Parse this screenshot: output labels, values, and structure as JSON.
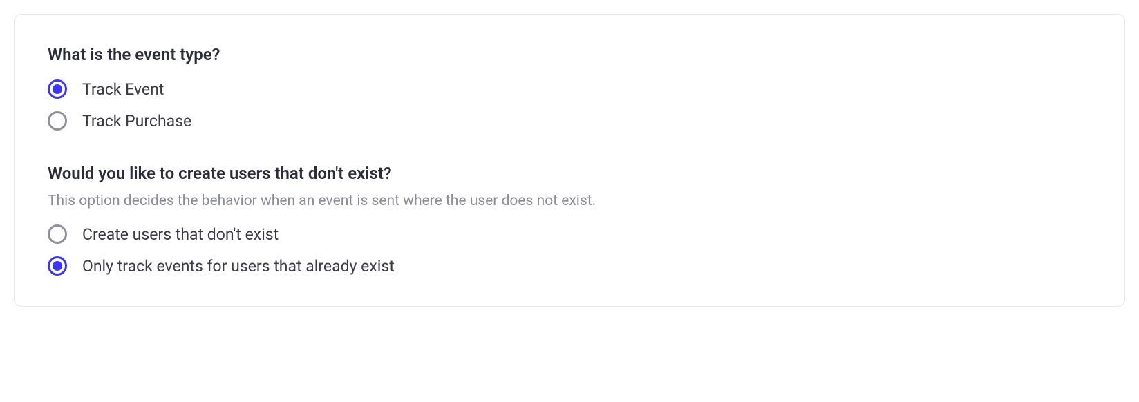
{
  "sections": [
    {
      "question": "What is the event type?",
      "helper": null,
      "options": [
        {
          "label": "Track Event",
          "selected": true
        },
        {
          "label": "Track Purchase",
          "selected": false
        }
      ]
    },
    {
      "question": "Would you like to create users that don't exist?",
      "helper": "This option decides the behavior when an event is sent where the user does not exist.",
      "options": [
        {
          "label": "Create users that don't exist",
          "selected": false
        },
        {
          "label": "Only track events for users that already exist",
          "selected": true
        }
      ]
    }
  ]
}
